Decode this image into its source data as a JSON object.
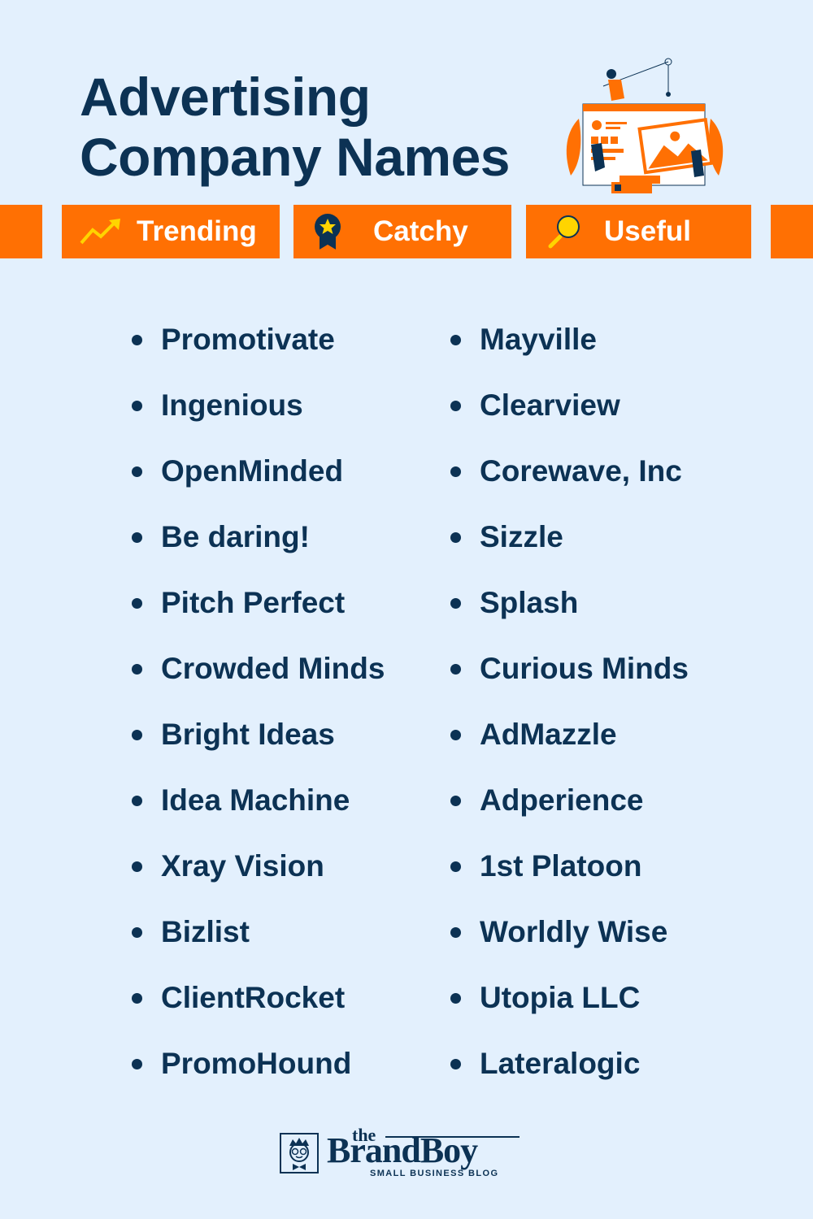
{
  "header": {
    "title_line1": "Advertising",
    "title_line2": "Company Names",
    "illustration": "advertising-web-banner-illustration-icon"
  },
  "tabs": [
    {
      "label": "Trending",
      "icon": "trending-up-arrow-icon"
    },
    {
      "label": "Catchy",
      "icon": "award-ribbon-star-icon"
    },
    {
      "label": "Useful",
      "icon": "magnifying-glass-icon"
    }
  ],
  "names": {
    "column1": [
      "Promotivate",
      "Ingenious",
      "OpenMinded",
      "Be daring!",
      "Pitch Perfect",
      "Crowded Minds",
      "Bright Ideas",
      "Idea Machine",
      "Xray Vision",
      "Bizlist",
      "ClientRocket",
      "PromoHound"
    ],
    "column2": [
      "Mayville",
      "Clearview",
      "Corewave, Inc",
      "Sizzle",
      "Splash",
      "Curious Minds",
      "AdMazzle",
      "Adperience",
      "1st Platoon",
      "Worldly Wise",
      "Utopia LLC",
      "Lateralogic"
    ]
  },
  "footer": {
    "logo_prefix": "the",
    "logo_name": "BrandBoy",
    "logo_tagline": "SMALL BUSINESS BLOG"
  },
  "colors": {
    "background": "#e3f0fd",
    "navy": "#0c3254",
    "orange": "#ff7003",
    "yellow": "#ffd400"
  }
}
